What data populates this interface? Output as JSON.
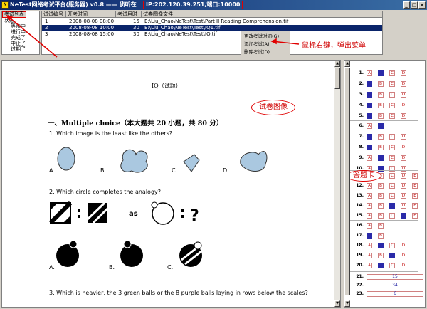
{
  "window": {
    "title": "NeTest网络考试平台(服务器) v0.8 —— 侦听在",
    "ip_port": "IP:202.120.39.251,端口:10000",
    "buttons": [
      "_",
      "□",
      "×"
    ]
  },
  "tree": {
    "tab": "考试列表",
    "root": "状态",
    "items": [
      "等待中",
      "进行中",
      "完成了",
      "中止了",
      "过期了"
    ]
  },
  "exam_list": {
    "columns": [
      "试试编号",
      "开考时间",
      "考试用时",
      "试卷图像文件"
    ],
    "rows": [
      {
        "id": "1",
        "start": "2008-08-08 08:00",
        "minutes": "15",
        "file": "E:\\Liu_Chao\\NeTest\\Test\\Part II Reading Comprehension.tif",
        "selected": false
      },
      {
        "id": "2",
        "start": "2008-08-08 10:00",
        "minutes": "30",
        "file": "E:\\Liu_Chao\\NeTest\\Test\\IQ1.tif",
        "selected": true
      },
      {
        "id": "3",
        "start": "2008-08-08 15:00",
        "minutes": "30",
        "file": "E:\\Liu_Chao\\NeTest\\Test\\IQ.tif",
        "selected": false
      }
    ]
  },
  "context_menu": {
    "items": [
      "更改考试时间(G)",
      "添加考试(A)",
      "删除考试(D)"
    ],
    "annotation": "鼠标右键，弹出菜单"
  },
  "paper": {
    "title": "IQ（试题）",
    "stamp_label": "试卷图像",
    "section_title": "一、Multiple choice（本大题共 20 小题，共 80 分）",
    "q1": "1. Which image is the least like the others?",
    "q1_options": [
      "A.",
      "B.",
      "C.",
      "D."
    ],
    "q2": "2. Which circle completes the analogy?",
    "q2_as": "as",
    "q2_options": [
      "A.",
      "B.",
      "C."
    ],
    "q3": "3. Which is heavier, the 3 green balls or the 8 purple balls laying in rows below the scales?"
  },
  "answer_card": {
    "label": "答题卡",
    "choice_letters": [
      "A",
      "B",
      "C",
      "D",
      "E"
    ],
    "rows": [
      {
        "num": "1.",
        "count": 4,
        "filled": [
          1
        ]
      },
      {
        "num": "2.",
        "count": 4,
        "filled": [
          0
        ]
      },
      {
        "num": "3.",
        "count": 4,
        "filled": [
          0
        ]
      },
      {
        "num": "4.",
        "count": 4,
        "filled": [
          0
        ]
      },
      {
        "num": "5.",
        "count": 4,
        "filled": [
          0
        ]
      },
      {
        "num": "6.",
        "count": 2,
        "filled": [
          1
        ]
      },
      {
        "num": "7.",
        "count": 4,
        "filled": [
          0
        ]
      },
      {
        "num": "8.",
        "count": 4,
        "filled": [
          0
        ]
      },
      {
        "num": "9.",
        "count": 4,
        "filled": [
          1
        ]
      },
      {
        "num": "10.",
        "count": 4,
        "filled": [
          1
        ]
      },
      {
        "num": "11.",
        "count": 5,
        "filled": []
      },
      {
        "num": "12.",
        "count": 5,
        "filled": []
      },
      {
        "num": "13.",
        "count": 5,
        "filled": []
      },
      {
        "num": "14.",
        "count": 5,
        "filled": [
          2
        ]
      },
      {
        "num": "15.",
        "count": 5,
        "filled": [
          3
        ]
      },
      {
        "num": "16.",
        "count": 2,
        "filled": []
      },
      {
        "num": "17.",
        "count": 2,
        "filled": [
          0
        ]
      },
      {
        "num": "18.",
        "count": 4,
        "filled": [
          1
        ]
      },
      {
        "num": "19.",
        "count": 4,
        "filled": [
          2
        ]
      },
      {
        "num": "20.",
        "count": 4,
        "filled": [
          1
        ]
      },
      {
        "num": "21.",
        "text": "15"
      },
      {
        "num": "22.",
        "text": "34"
      },
      {
        "num": "23.",
        "text": "6"
      }
    ]
  },
  "colors": {
    "title_bar": "#0a246a",
    "selection": "#0a246a",
    "annotation_red": "#e00000",
    "filled_bubble": "#2a2aa8"
  }
}
